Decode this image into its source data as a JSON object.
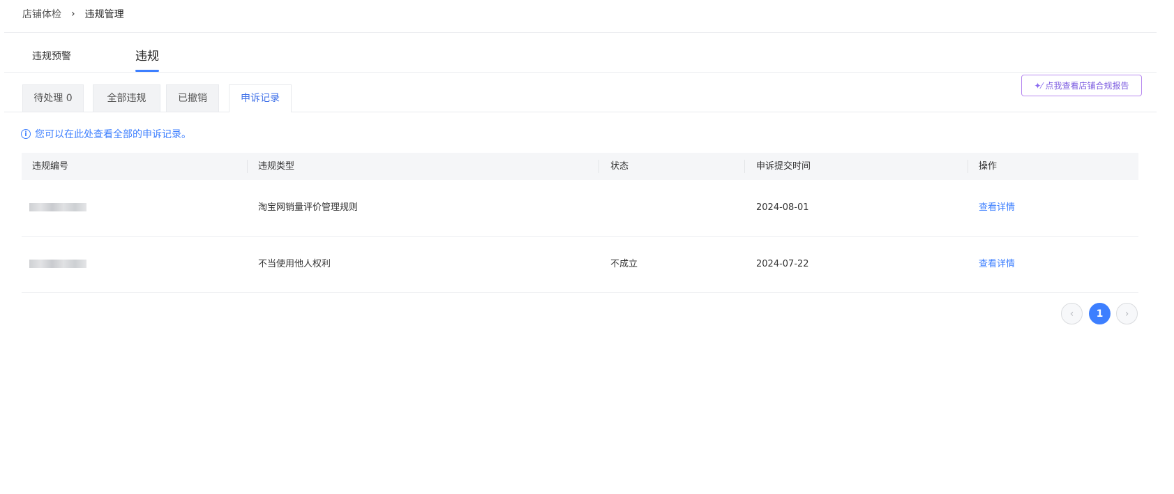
{
  "breadcrumb": {
    "parent": "店铺体检",
    "separator": "›",
    "current": "违规管理"
  },
  "main_tabs": [
    {
      "label": "违规预警",
      "active": false
    },
    {
      "label": "违规",
      "active": true
    }
  ],
  "sub_tabs": [
    {
      "label": "待处理 0",
      "active": false
    },
    {
      "label": "全部违规",
      "active": false
    },
    {
      "label": "已撤销",
      "active": false
    },
    {
      "label": "申诉记录",
      "active": true
    }
  ],
  "report_button": {
    "label": "点我查看店铺合规报告",
    "icon": "sparkle-wand-icon"
  },
  "notice": {
    "text": "您可以在此处查看全部的申诉记录。",
    "icon": "info-icon"
  },
  "table": {
    "headers": [
      "违规编号",
      "违规类型",
      "状态",
      "申诉提交时间",
      "操作"
    ],
    "rows": [
      {
        "violation_type": "淘宝网销量评价管理规则",
        "status": "",
        "submit_time": "2024-08-01",
        "action": "查看详情"
      },
      {
        "violation_type": "不当使用他人权利",
        "status": "不成立",
        "submit_time": "2024-07-22",
        "action": "查看详情"
      }
    ]
  },
  "pagination": {
    "prev_icon": "‹",
    "current_page": "1",
    "next_icon": "›"
  },
  "colors": {
    "accent": "#3d7fff",
    "report_border": "#b98cf0"
  }
}
